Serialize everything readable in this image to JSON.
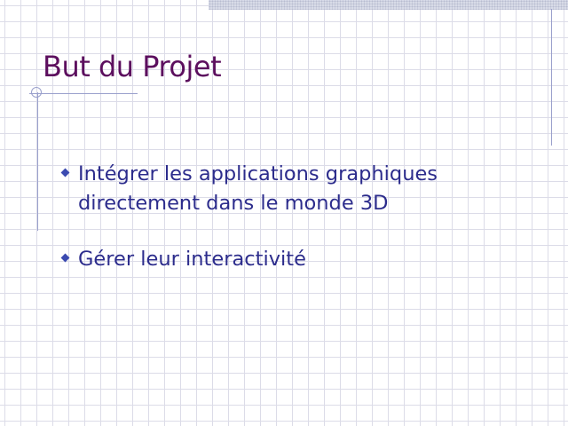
{
  "slide": {
    "title": "But du Projet",
    "bullets": [
      {
        "text": "Intégrer les applications graphiques directement dans le monde 3D",
        "icon": "diamond-bullet-icon"
      },
      {
        "text": "Gérer leur interactivité",
        "icon": "diamond-bullet-icon"
      }
    ]
  },
  "colors": {
    "title": "#5c0f5e",
    "body_text": "#2c2c8c",
    "bullet": "#3b4ab0",
    "grid": "#dcdce8",
    "rules": "#9aa0cc"
  }
}
